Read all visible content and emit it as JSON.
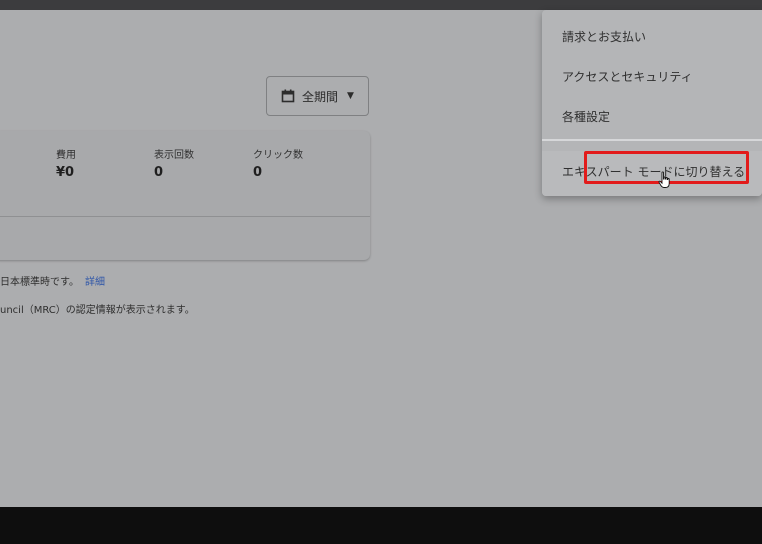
{
  "toolbar": {
    "date_range_label": "全期間",
    "calendar_icon": "calendar-icon",
    "dropdown_icon": "caret-down-icon"
  },
  "stats": [
    {
      "label": "費用",
      "value": "¥0"
    },
    {
      "label": "表示回数",
      "value": "0"
    },
    {
      "label": "クリック数",
      "value": "0"
    }
  ],
  "notes": {
    "timezone_text": "日本標準時です。",
    "details_link": "詳細",
    "mrc_text": "uncil（MRC）の認定情報が表示されます。"
  },
  "menu": {
    "items": [
      {
        "label": "請求とお支払い"
      },
      {
        "label": "アクセスとセキュリティ"
      },
      {
        "label": "各種設定"
      }
    ],
    "expert_mode_label": "エキスパート モードに切り替える"
  },
  "colors": {
    "highlight": "#e21b1b",
    "link": "#2f56a8"
  }
}
